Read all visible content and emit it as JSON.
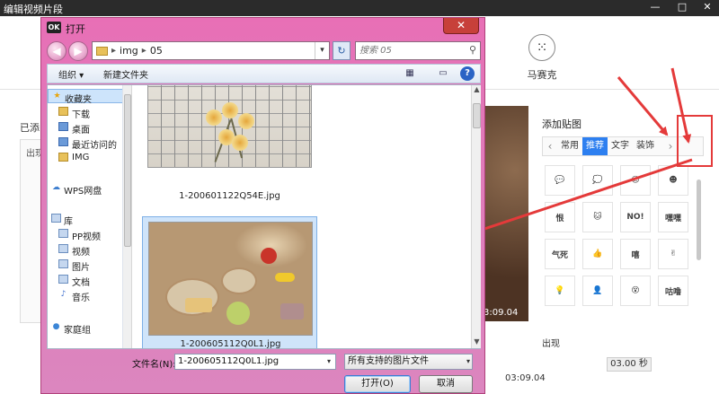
{
  "app": {
    "title": "编辑视频片段",
    "window_controls": [
      "—",
      "□",
      "✕"
    ],
    "mosaic_tool_label": "马赛克",
    "left_panel_label": "已添",
    "left_panel_sublabel": "出现",
    "video_timecode": "3:09.04",
    "sticker_panel": {
      "title": "添加贴图",
      "prev_arrow": "‹",
      "next_arrow": "›",
      "tabs": [
        "常用",
        "推荐",
        "文字",
        "装饰"
      ],
      "active_tab": "推荐",
      "stickers": [
        "💬",
        "💭",
        "☺",
        "☻",
        "恨",
        "🐱",
        "NO!",
        "嘿嘿",
        "气死",
        "👍",
        "嘻",
        "✌",
        "💡",
        "👤",
        "😵",
        "咕噜"
      ]
    },
    "out_label": "出现",
    "bottom_timecode": "03:09.04",
    "time_box": "03.00 秒"
  },
  "dialog": {
    "title": "打开",
    "logo_text": "OK",
    "close_label": "✕",
    "back_label": "◀",
    "forward_label": "▶",
    "breadcrumb": [
      "img",
      "05"
    ],
    "crumb_sep": "▸",
    "addr_dropdown": "▾",
    "refresh_label": "↻",
    "search_placeholder": "搜索 05",
    "search_icon": "magnifier-icon",
    "organize_label": "组织 ▾",
    "new_folder_label": "新建文件夹",
    "view_icon": "▦",
    "pane_icon": "▭",
    "help_label": "?",
    "nav": {
      "favorites": "收藏夹",
      "downloads": "下载",
      "desktop": "桌面",
      "recent": "最近访问的",
      "img": "IMG",
      "wps": "WPS网盘",
      "library": "库",
      "pp_video": "PP视频",
      "video": "视频",
      "pictures": "图片",
      "documents": "文档",
      "music": "音乐",
      "homegroup": "家庭组"
    },
    "files": [
      {
        "name": "1-200601122Q54E.jpg",
        "selected": false
      },
      {
        "name": "1-200605112Q0L1.jpg",
        "selected": true
      }
    ],
    "filename_label": "文件名(N):",
    "filename_value": "1-200605112Q0L1.jpg",
    "filetype_value": "所有支持的图片文件",
    "open_button": "打开(O)",
    "cancel_button": "取消",
    "scroll_up": "▲",
    "scroll_down": "▼",
    "dropdown_arrow": "▾"
  },
  "colors": {
    "annotation_red": "#e43a3a",
    "dialog_frame": "#e079b9",
    "selection_blue": "#cfe4fa",
    "active_tab_blue": "#2d7ff0"
  }
}
